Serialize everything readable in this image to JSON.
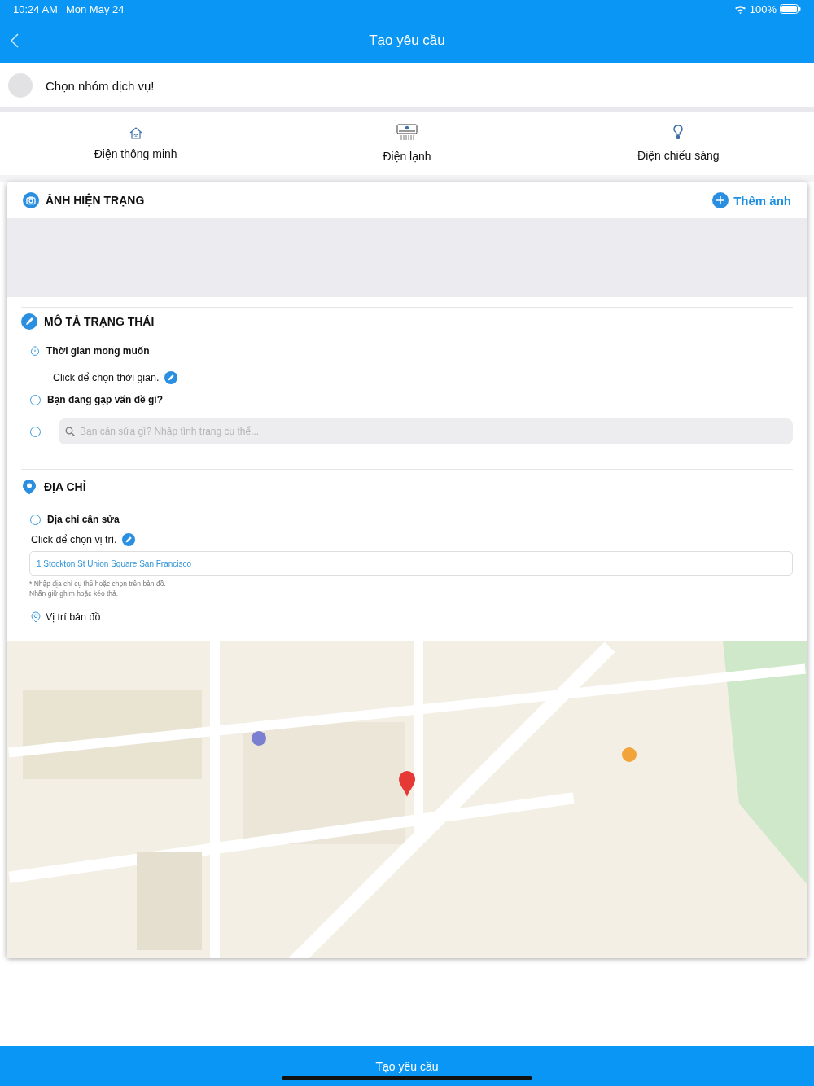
{
  "status_bar": {
    "time": "10:24 AM",
    "date": "Mon May 24",
    "battery": "100%"
  },
  "nav": {
    "title": "Tạo yêu cầu"
  },
  "service_group": {
    "label": "Chọn nhóm dịch vụ!"
  },
  "categories": [
    {
      "label": "Điện thông minh",
      "kind": "smart_home"
    },
    {
      "label": "Điện lạnh",
      "kind": "air_conditioner"
    },
    {
      "label": "Điện chiếu sáng",
      "kind": "bulb"
    }
  ],
  "photo_section": {
    "title": "ẢNH HIỆN TRẠNG",
    "add_button": "Thêm ảnh"
  },
  "status_section": {
    "title": "MÔ TẢ TRẠNG THÁI",
    "time": {
      "label": "Thời gian mong muốn",
      "hint": "Click để chọn thời gian."
    },
    "problem": {
      "label": "Bạn đang gặp vấn đề gì?",
      "checked": false
    },
    "description": {
      "placeholder": "Bạn cần sửa gì? Nhập tình trạng cụ thể...",
      "checked": false
    }
  },
  "address_section": {
    "title": "ĐỊA CHỈ",
    "address": {
      "label": "Địa chỉ cần sửa",
      "checked": false,
      "hint": "Click để chọn vị trí.",
      "value": "1 Stockton St Union Square San Francisco",
      "notes": [
        "* Nhập địa chỉ cụ thể hoặc chọn trên bản đồ.",
        "Nhấn giữ ghim hoặc kéo thả."
      ]
    },
    "map_label": "Vị trí bản đồ"
  },
  "submit_button": "Tạo yêu cầu"
}
